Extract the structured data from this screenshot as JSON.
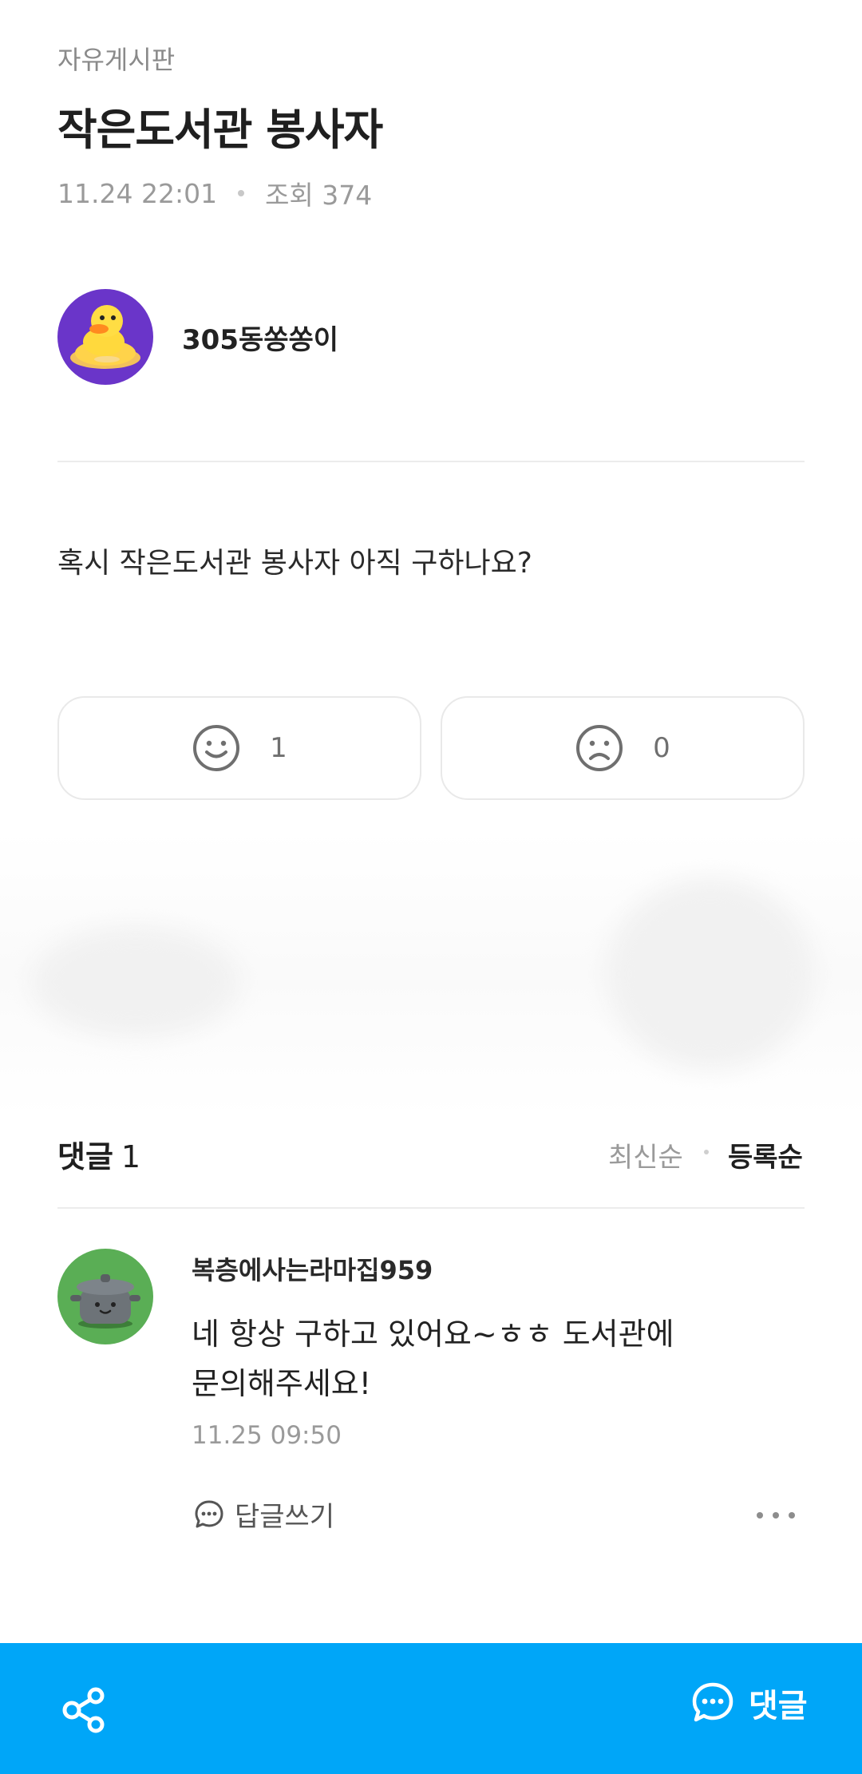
{
  "post": {
    "category": "자유게시판",
    "title": "작은도서관 봉사자",
    "date": "11.24 22:01",
    "views": "조회 374",
    "author": "305동쏭쏭이",
    "body": "혹시 작은도서관 봉사자 아직 구하나요?"
  },
  "reactions": {
    "like_count": "1",
    "dislike_count": "0"
  },
  "comments": {
    "title": "댓글",
    "count": "1",
    "sort_latest": "최신순",
    "sort_register": "등록순",
    "items": [
      {
        "author": "복층에사는라마집959",
        "text_line1": "네 항상 구하고 있어요~ㅎㅎ 도서관에",
        "text_line2": "문의해주세요!",
        "time": "11.25 09:50",
        "reply_label": "답글쓰기"
      }
    ]
  },
  "bottom_bar": {
    "comment_label": "댓글",
    "color": "#00a6f8"
  },
  "icons": {
    "author_avatar": "duck-avatar-icon",
    "comment_avatar": "pot-avatar-icon",
    "like": "smile-icon",
    "dislike": "frown-icon",
    "reply": "speech-bubble-icon",
    "more": "more-dots-icon",
    "share": "share-icon",
    "comment": "comment-bubble-icon"
  }
}
